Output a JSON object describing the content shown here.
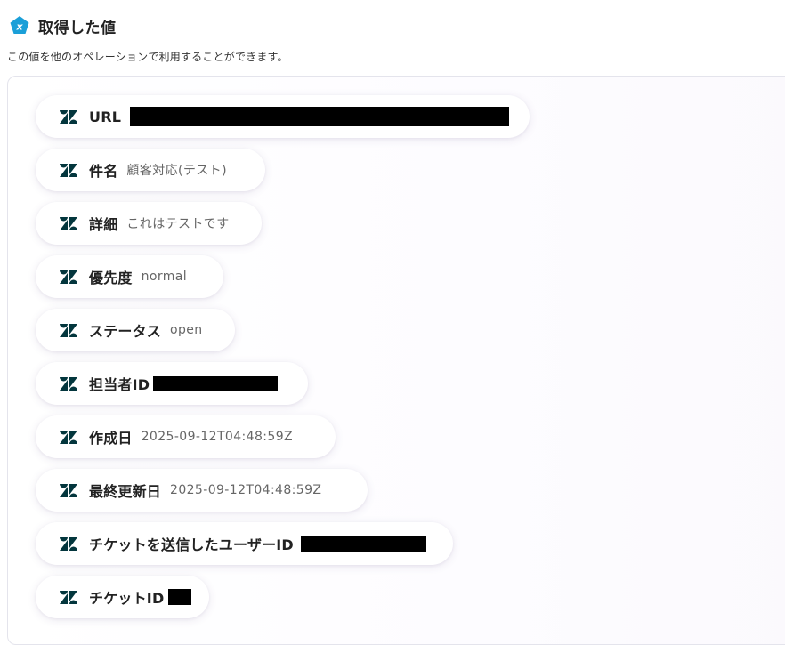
{
  "header": {
    "title": "取得した値",
    "icon": "yoom-logo-icon",
    "icon_color": "#1a9fd8"
  },
  "subtitle": "この値を他のオペレーションで利用することができます。",
  "items": [
    {
      "key": "URL",
      "value": "",
      "redacted": true,
      "icon": "zendesk-icon"
    },
    {
      "key": "件名",
      "value": "顧客対応(テスト)",
      "redacted": false,
      "icon": "zendesk-icon"
    },
    {
      "key": "詳細",
      "value": "これはテストです",
      "redacted": false,
      "icon": "zendesk-icon"
    },
    {
      "key": "優先度",
      "value": "normal",
      "redacted": false,
      "icon": "zendesk-icon"
    },
    {
      "key": "ステータス",
      "value": "open",
      "redacted": false,
      "icon": "zendesk-icon"
    },
    {
      "key": "担当者ID",
      "value": "",
      "redacted": true,
      "icon": "zendesk-icon"
    },
    {
      "key": "作成日",
      "value": "2025-09-12T04:48:59Z",
      "redacted": false,
      "icon": "zendesk-icon"
    },
    {
      "key": "最終更新日",
      "value": "2025-09-12T04:48:59Z",
      "redacted": false,
      "icon": "zendesk-icon"
    },
    {
      "key": "チケットを送信したユーザーID",
      "value": "",
      "redacted": true,
      "icon": "zendesk-icon"
    },
    {
      "key": "チケットID",
      "value": "",
      "redacted": true,
      "icon": "zendesk-icon"
    }
  ],
  "colors": {
    "zendesk_icon": "#03363d",
    "redaction": "#000000"
  }
}
